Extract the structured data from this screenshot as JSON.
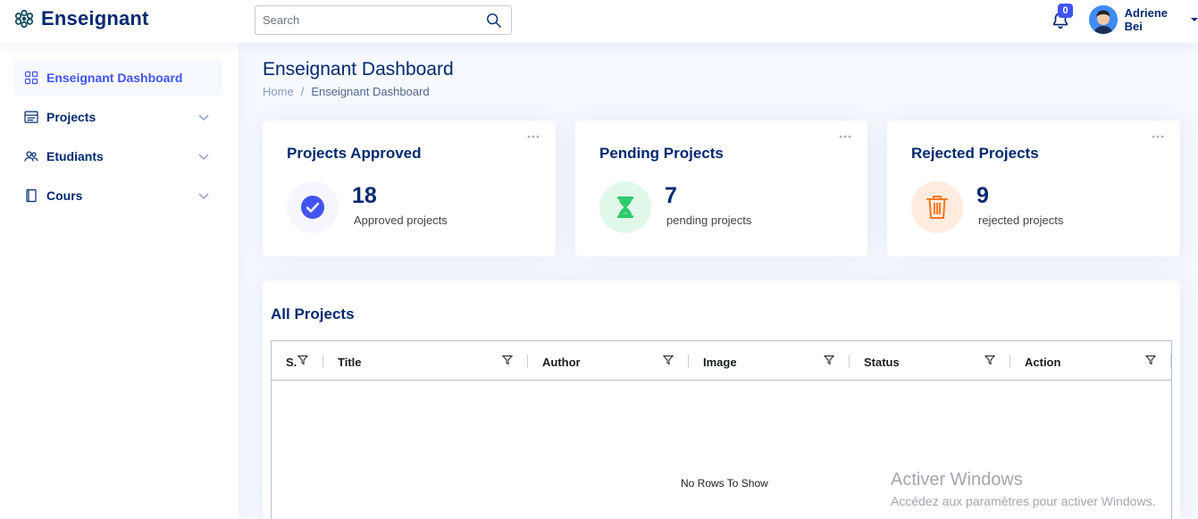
{
  "app": {
    "name": "Enseignant"
  },
  "header": {
    "search_placeholder": "Search",
    "notifications_count": "0",
    "user_name": "Adriene Bei"
  },
  "sidebar": {
    "items": [
      {
        "label": "Enseignant Dashboard",
        "icon": "grid-icon",
        "active": true
      },
      {
        "label": "Projects",
        "icon": "layout-text-icon",
        "expandable": true
      },
      {
        "label": "Etudiants",
        "icon": "people-icon",
        "expandable": true
      },
      {
        "label": "Cours",
        "icon": "book-icon",
        "expandable": true
      }
    ]
  },
  "page": {
    "title": "Enseignant Dashboard",
    "breadcrumb": {
      "home": "Home",
      "separator": "/",
      "current": "Enseignant Dashboard"
    }
  },
  "cards": [
    {
      "title": "Projects Approved",
      "value": "18",
      "subtitle": "Approved projects",
      "icon": "check-circle-icon",
      "color": "#4154f1",
      "bg": "#f6f6fe"
    },
    {
      "title": "Pending Projects",
      "value": "7",
      "subtitle": "pending projects",
      "icon": "hourglass-icon",
      "color": "#2eca6a",
      "bg": "#e0f8e9"
    },
    {
      "title": "Rejected Projects",
      "value": "9",
      "subtitle": "rejected projects",
      "icon": "trash-icon",
      "color": "#ff771d",
      "bg": "#ffecdf"
    }
  ],
  "projects": {
    "title": "All Projects",
    "columns": [
      "S.",
      "Title",
      "Author",
      "Image",
      "Status",
      "Action"
    ],
    "empty_text": "No Rows To Show"
  },
  "watermark": {
    "title": "Activer Windows",
    "subtitle": "Accédez aux paramètres pour activer Windows."
  },
  "colors": {
    "primary": "#4154f1",
    "navy": "#012970",
    "page_bg": "#f6f9ff"
  }
}
